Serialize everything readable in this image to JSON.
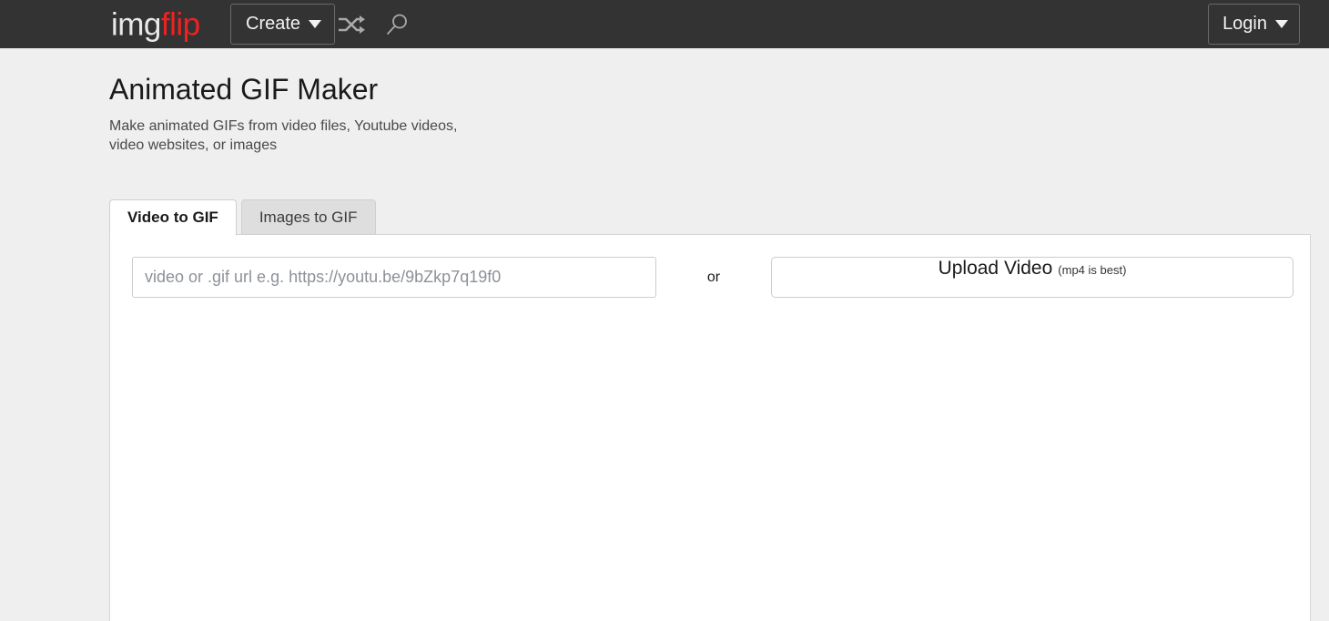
{
  "header": {
    "logo_img": "img",
    "logo_flip": "flip",
    "create_label": "Create",
    "shuffle_icon": "shuffle-icon",
    "search_icon": "search-icon",
    "login_label": "Login"
  },
  "page": {
    "title": "Animated GIF Maker",
    "subtitle": "Make animated GIFs from video files, Youtube videos, video websites, or images"
  },
  "tabs": [
    {
      "label": "Video to GIF",
      "active": true
    },
    {
      "label": "Images to GIF",
      "active": false
    }
  ],
  "main": {
    "url_input": {
      "placeholder": "video or .gif url e.g. https://youtu.be/9bZkp7q19f0",
      "value": ""
    },
    "or_label": "or",
    "upload_button": {
      "main_label": "Upload Video",
      "sub_label": "(mp4 is best)"
    }
  },
  "colors": {
    "header_bg": "#333333",
    "page_bg": "#efefef",
    "panel_bg": "#ffffff",
    "logo_accent": "#ef2121",
    "tab_inactive_bg": "#dedede",
    "border": "#cccccc"
  }
}
